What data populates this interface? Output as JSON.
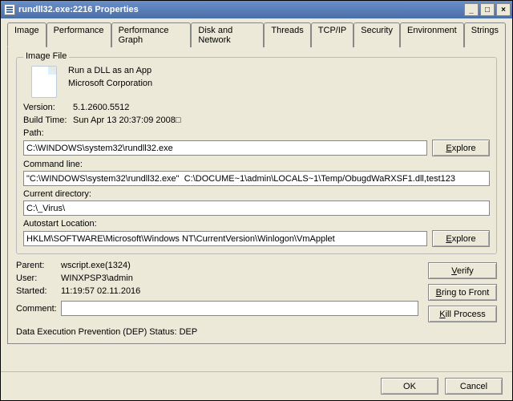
{
  "window": {
    "title": "rundll32.exe:2216 Properties",
    "min_glyph": "_",
    "max_glyph": "□",
    "close_glyph": "×"
  },
  "tabs": [
    "Image",
    "Performance",
    "Performance Graph",
    "Disk and Network",
    "Threads",
    "TCP/IP",
    "Security",
    "Environment",
    "Strings"
  ],
  "groupbox": {
    "legend": "Image File",
    "desc": "Run a DLL as an App",
    "company": "Microsoft Corporation",
    "version_label": "Version:",
    "version_value": "5.1.2600.5512",
    "buildtime_label": "Build Time:",
    "buildtime_value": "Sun Apr 13 20:37:09 2008□",
    "path_label": "Path:",
    "path_value": "C:\\WINDOWS\\system32\\rundll32.exe",
    "cmdline_label": "Command line:",
    "cmdline_value": "\"C:\\WINDOWS\\system32\\rundll32.exe\"  C:\\DOCUME~1\\admin\\LOCALS~1\\Temp/ObugdWaRXSF1.dll,test123",
    "curdir_label": "Current directory:",
    "curdir_value": "C:\\_Virus\\",
    "autostart_label": "Autostart Location:",
    "autostart_value": "HKLM\\SOFTWARE\\Microsoft\\Windows NT\\CurrentVersion\\Winlogon\\VmApplet",
    "explore_label": "Explore"
  },
  "below": {
    "parent_label": "Parent:",
    "parent_value": "wscript.exe(1324)",
    "user_label": "User:",
    "user_value": "WINXPSP3\\admin",
    "started_label": "Started:",
    "started_value": "11:19:57   02.11.2016",
    "comment_label": "Comment:",
    "comment_value": ""
  },
  "buttons": {
    "verify": "Verify",
    "bring": "Bring to Front",
    "kill": "Kill Process",
    "ok": "OK",
    "cancel": "Cancel"
  },
  "dep": "Data Execution Prevention (DEP) Status: DEP"
}
